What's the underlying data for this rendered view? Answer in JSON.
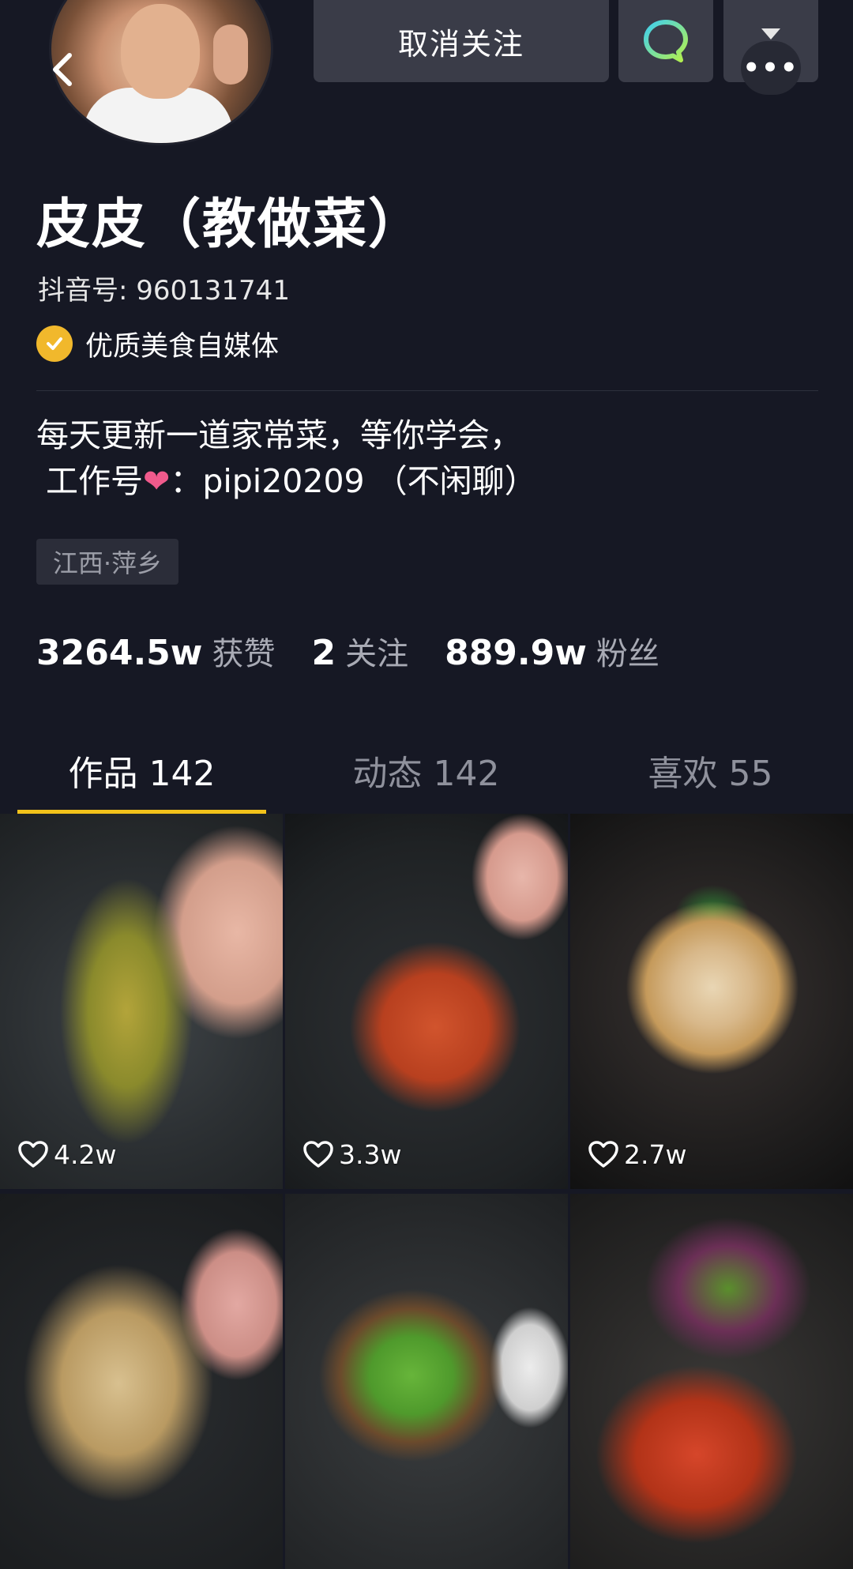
{
  "header": {
    "unfollow_label": "取消关注",
    "more_dots": "•••"
  },
  "profile": {
    "name": "皮皮（教做菜）",
    "douyin_id": "抖音号: 960131741",
    "verified_label": "优质美食自媒体",
    "bio_line1": "每天更新一道家常菜，等你学会，",
    "bio_line2_prefix": "工作号",
    "bio_line2_suffix": "：pipi20209 （不闲聊）",
    "location": "江西·萍乡"
  },
  "stats": [
    {
      "value": "3264.5w",
      "label": "获赞"
    },
    {
      "value": "2",
      "label": "关注"
    },
    {
      "value": "889.9w",
      "label": "粉丝"
    }
  ],
  "tabs": [
    {
      "label": "作品 142",
      "active": true
    },
    {
      "label": "动态 142",
      "active": false
    },
    {
      "label": "喜欢 55",
      "active": false
    }
  ],
  "videos": [
    {
      "likes": "4.2w",
      "thumb": "fish-in-wok"
    },
    {
      "likes": "3.3w",
      "thumb": "sweet-sour-pork"
    },
    {
      "likes": "2.7w",
      "thumb": "fish-claypot"
    },
    {
      "likes": "",
      "thumb": "fried-noodles"
    },
    {
      "likes": "",
      "thumb": "pepper-meat"
    },
    {
      "likes": "",
      "thumb": "crayfish"
    }
  ],
  "colors": {
    "background": "#161824",
    "accent": "#f2c21a",
    "verified_badge": "#f1b82c",
    "heart": "#f05a8c"
  },
  "icons": [
    "back-arrow-icon",
    "chat-bubble-icon",
    "dropdown-triangle-icon",
    "more-dots-icon",
    "verified-check-icon",
    "heart-icon"
  ]
}
